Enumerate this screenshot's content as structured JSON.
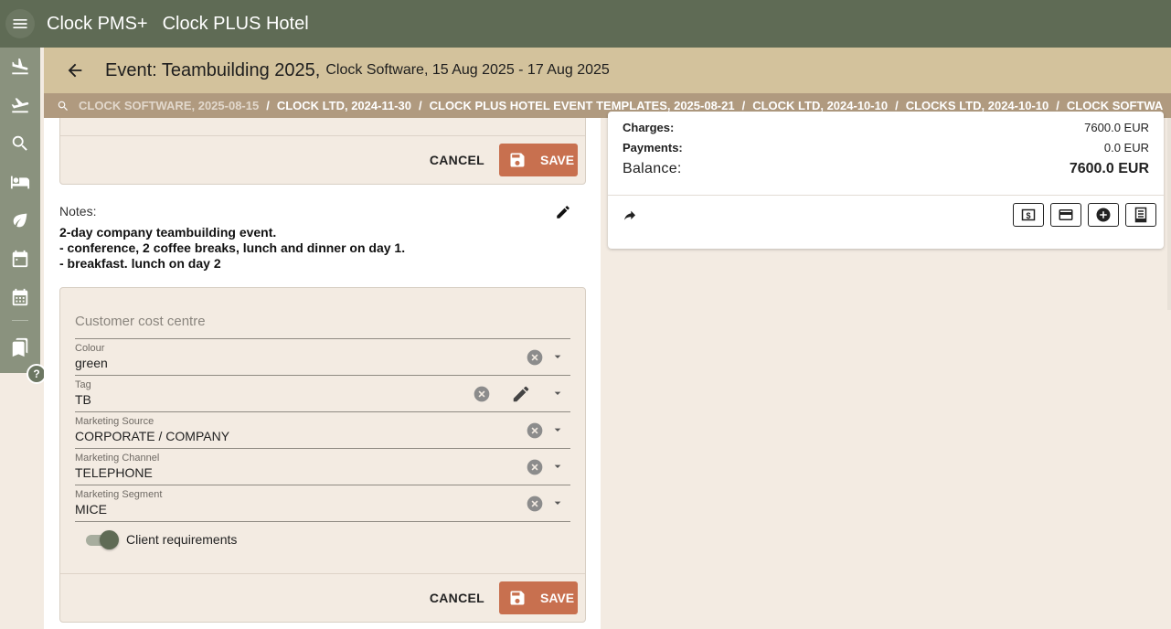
{
  "appbar": {
    "app_name": "Clock PMS+",
    "hotel_name": "Clock PLUS Hotel"
  },
  "title": {
    "main": "Event: Teambuilding 2025,",
    "sub": "Clock Software, 15 Aug 2025 - 17 Aug 2025"
  },
  "breadcrumbs": [
    "CLOCK SOFTWARE, 2025-08-15",
    "CLOCK LTD, 2024-11-30",
    "CLOCK PLUS HOTEL EVENT TEMPLATES, 2025-08-21",
    "CLOCK LTD, 2024-10-10",
    "CLOCKS LTD, 2024-10-10",
    "CLOCK SOFTWA"
  ],
  "breadcrumb_separator": "/",
  "buttons": {
    "cancel": "CANCEL",
    "save": "SAVE"
  },
  "notes": {
    "label": "Notes:",
    "lines": [
      "2-day company teambuilding event.",
      "- conference, 2 coffee breaks, lunch and dinner on day 1.",
      "- breakfast. lunch on day 2"
    ]
  },
  "form": {
    "cost_centre_placeholder": "Customer cost centre",
    "fields": [
      {
        "label": "Colour",
        "value": "green"
      },
      {
        "label": "Tag",
        "value": "TB"
      },
      {
        "label": "Marketing Source",
        "value": "CORPORATE / COMPANY"
      },
      {
        "label": "Marketing Channel",
        "value": "TELEPHONE"
      },
      {
        "label": "Marketing Segment",
        "value": "MICE"
      }
    ],
    "toggle_label": "Client requirements",
    "toggle_on": true
  },
  "summary": {
    "charges_label": "Charges:",
    "charges_value": "7600.0 EUR",
    "payments_label": "Payments:",
    "payments_value": "0.0 EUR",
    "balance_label": "Balance:",
    "balance_value": "7600.0 EUR"
  },
  "help_badge": "?",
  "colors": {
    "appbar": "#5f6b55",
    "rail": "#8a927e",
    "titlebar": "#d3c29c",
    "breadcrumb": "#b09a7f",
    "save_button": "#c8704f",
    "background": "#f3ebe2"
  },
  "rail_icons": [
    "flight-land-icon",
    "flight-takeoff-icon",
    "search-icon",
    "bed-icon",
    "leaf-icon",
    "calendar-icon",
    "calendar-grid-icon",
    "bookmarks-icon"
  ],
  "summary_icons": [
    "forward-icon",
    "cash-icon",
    "credit-card-icon",
    "add-circle-icon",
    "receipt-icon"
  ]
}
